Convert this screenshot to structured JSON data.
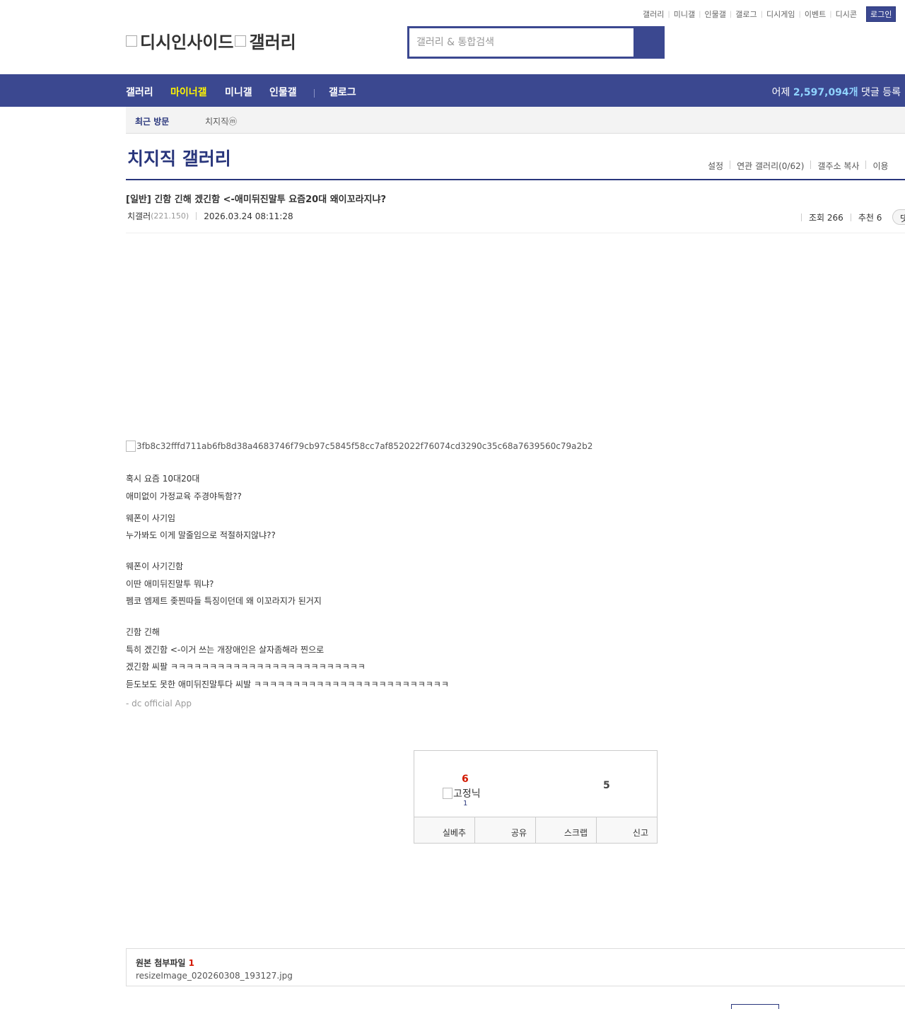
{
  "top_links": [
    "갤러리",
    "미니갤",
    "인물갤",
    "갤로그",
    "디시게임",
    "이벤트",
    "디시콘"
  ],
  "login_label": "로그인",
  "logo": {
    "main": "디시인사이드",
    "sub": "갤러리"
  },
  "search": {
    "placeholder": "갤러리 & 통합검색"
  },
  "nav": {
    "items": [
      "갤러리",
      "마이너갤",
      "미니갤",
      "인물갤",
      "갤로그"
    ],
    "stat_prefix": "어제",
    "stat_count": "2,597,094개",
    "stat_suffix": "댓글 등록"
  },
  "recent": {
    "title": "최근 방문",
    "item": "치지직ⓜ"
  },
  "gallery": {
    "title": "치지직 갤러리",
    "options": [
      "설정",
      "연관 갤러리(0/62)",
      "갤주소 복사",
      "이용"
    ]
  },
  "post": {
    "title": "[일반] 긴함 긴해 겠긴함 <-애미뒤진말투 요즘20대 왜이꼬라지냐?",
    "author": "치갤러",
    "ip": "(221.150)",
    "date": "2026.03.24 08:11:28",
    "views": "조회 266",
    "recommend": "추천 6",
    "reply_short": "댓",
    "image_alt": "3fb8c32fffd711ab6fb8d38a4683746f79cb97c5845f58cc7af852022f76074cd3290c35c68a7639560c79a2b2",
    "body": [
      "혹시 요즘 10대20대",
      "애미없이 가정교육 주경야독함??",
      "웨폰이 사기임",
      "누가봐도 이게 말줄임으로 적절하지않냐??",
      "웨폰이 사기긴함",
      "이딴 애미뒤진말투 뭐냐?",
      "펨코 엠제트 좆찐따들 특징이던데 왜 이꼬라지가 된거지",
      "긴함 긴해",
      "특히 겠긴함 <-이거 쓰는 개장애인은 살자좀해라 찐으로",
      "겠긴함 씨팔 ㅋㅋㅋㅋㅋㅋㅋㅋㅋㅋㅋㅋㅋㅋㅋㅋㅋㅋㅋㅋㅋㅋㅋㅋㅋ",
      "듣도보도 못한 애미뒤진말투다 씨발 ㅋㅋㅋㅋㅋㅋㅋㅋㅋㅋㅋㅋㅋㅋㅋㅋㅋㅋㅋㅋㅋㅋㅋㅋㅋ"
    ],
    "app_signature": "- dc official App"
  },
  "vote": {
    "up": "6",
    "fixed_label": "고정닉",
    "fixed_count": "1",
    "down": "5",
    "buttons": [
      "실베추",
      "공유",
      "스크랩",
      "신고"
    ]
  },
  "attachment": {
    "title": "원본 첨부파일",
    "count": "1",
    "file": "resizeImage_020260308_193127.jpg"
  },
  "colors": {
    "brand": "#3b4890",
    "brand_dark": "#29367c",
    "highlight": "#fff500",
    "stat": "#8fd3ff",
    "red": "#d31900"
  }
}
